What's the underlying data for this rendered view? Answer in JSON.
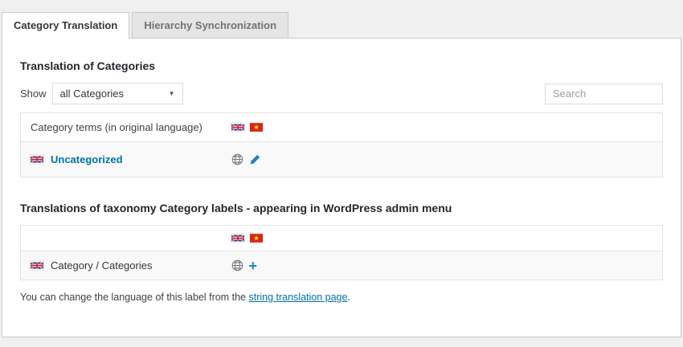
{
  "tabs": {
    "category_translation": "Category Translation",
    "hierarchy_synchronization": "Hierarchy Synchronization"
  },
  "section_categories": {
    "title": "Translation of Categories",
    "show_label": "Show",
    "filter_selected_option": "all Categories",
    "search_placeholder": "Search",
    "table": {
      "header_col1": "Category terms (in original language)",
      "header_language_icons": [
        "uk-flag-icon",
        "vietnam-flag-icon"
      ],
      "row": {
        "term": "Uncategorized",
        "term_flag_icon": "uk-flag-icon",
        "action_icons": [
          "globe-icon",
          "edit-pencil-icon"
        ]
      }
    }
  },
  "section_labels": {
    "title": "Translations of taxonomy Category labels - appearing in WordPress admin menu",
    "table": {
      "header_language_icons": [
        "uk-flag-icon",
        "vietnam-flag-icon"
      ],
      "row": {
        "term": "Category / Categories",
        "term_flag_icon": "uk-flag-icon",
        "action_icons": [
          "globe-icon",
          "add-plus-icon"
        ]
      }
    },
    "footer": {
      "text_before": "You can change the language of this label from the ",
      "link_text": "string translation page",
      "text_after": "."
    }
  },
  "icons": {
    "select_arrow": "▼",
    "plus_glyph": "+"
  },
  "colors": {
    "page_background": "#f0f0f1",
    "panel_background": "#ffffff",
    "link_blue": "#0073aa",
    "icon_blue": "#1e82c8",
    "row_stripe": "#f9f9f9",
    "uk_flag_blue": "#00247d",
    "flag_red": "#cf142b",
    "vietnam_flag_red": "#da251d",
    "vietnam_star_yellow": "#ffff00"
  }
}
